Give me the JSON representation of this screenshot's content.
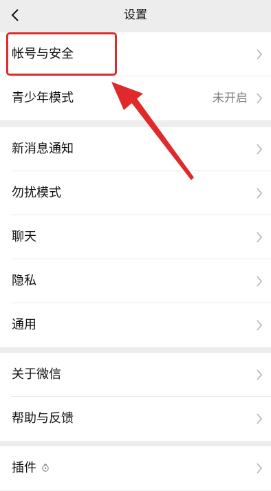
{
  "nav": {
    "title": "设置",
    "back_icon": "chevron-left-icon"
  },
  "groups": [
    {
      "items": [
        {
          "label": "帐号与安全",
          "value": ""
        },
        {
          "label": "青少年模式",
          "value": "未开启"
        }
      ]
    },
    {
      "items": [
        {
          "label": "新消息通知",
          "value": ""
        },
        {
          "label": "勿扰模式",
          "value": ""
        },
        {
          "label": "聊天",
          "value": ""
        },
        {
          "label": "隐私",
          "value": ""
        },
        {
          "label": "通用",
          "value": ""
        }
      ]
    },
    {
      "items": [
        {
          "label": "关于微信",
          "value": ""
        },
        {
          "label": "帮助与反馈",
          "value": ""
        }
      ]
    },
    {
      "items": [
        {
          "label": "插件",
          "value": "",
          "icon": "plugin-icon"
        }
      ]
    }
  ],
  "annotation": {
    "color": "#e0292a",
    "highlight_target": "帐号与安全"
  }
}
